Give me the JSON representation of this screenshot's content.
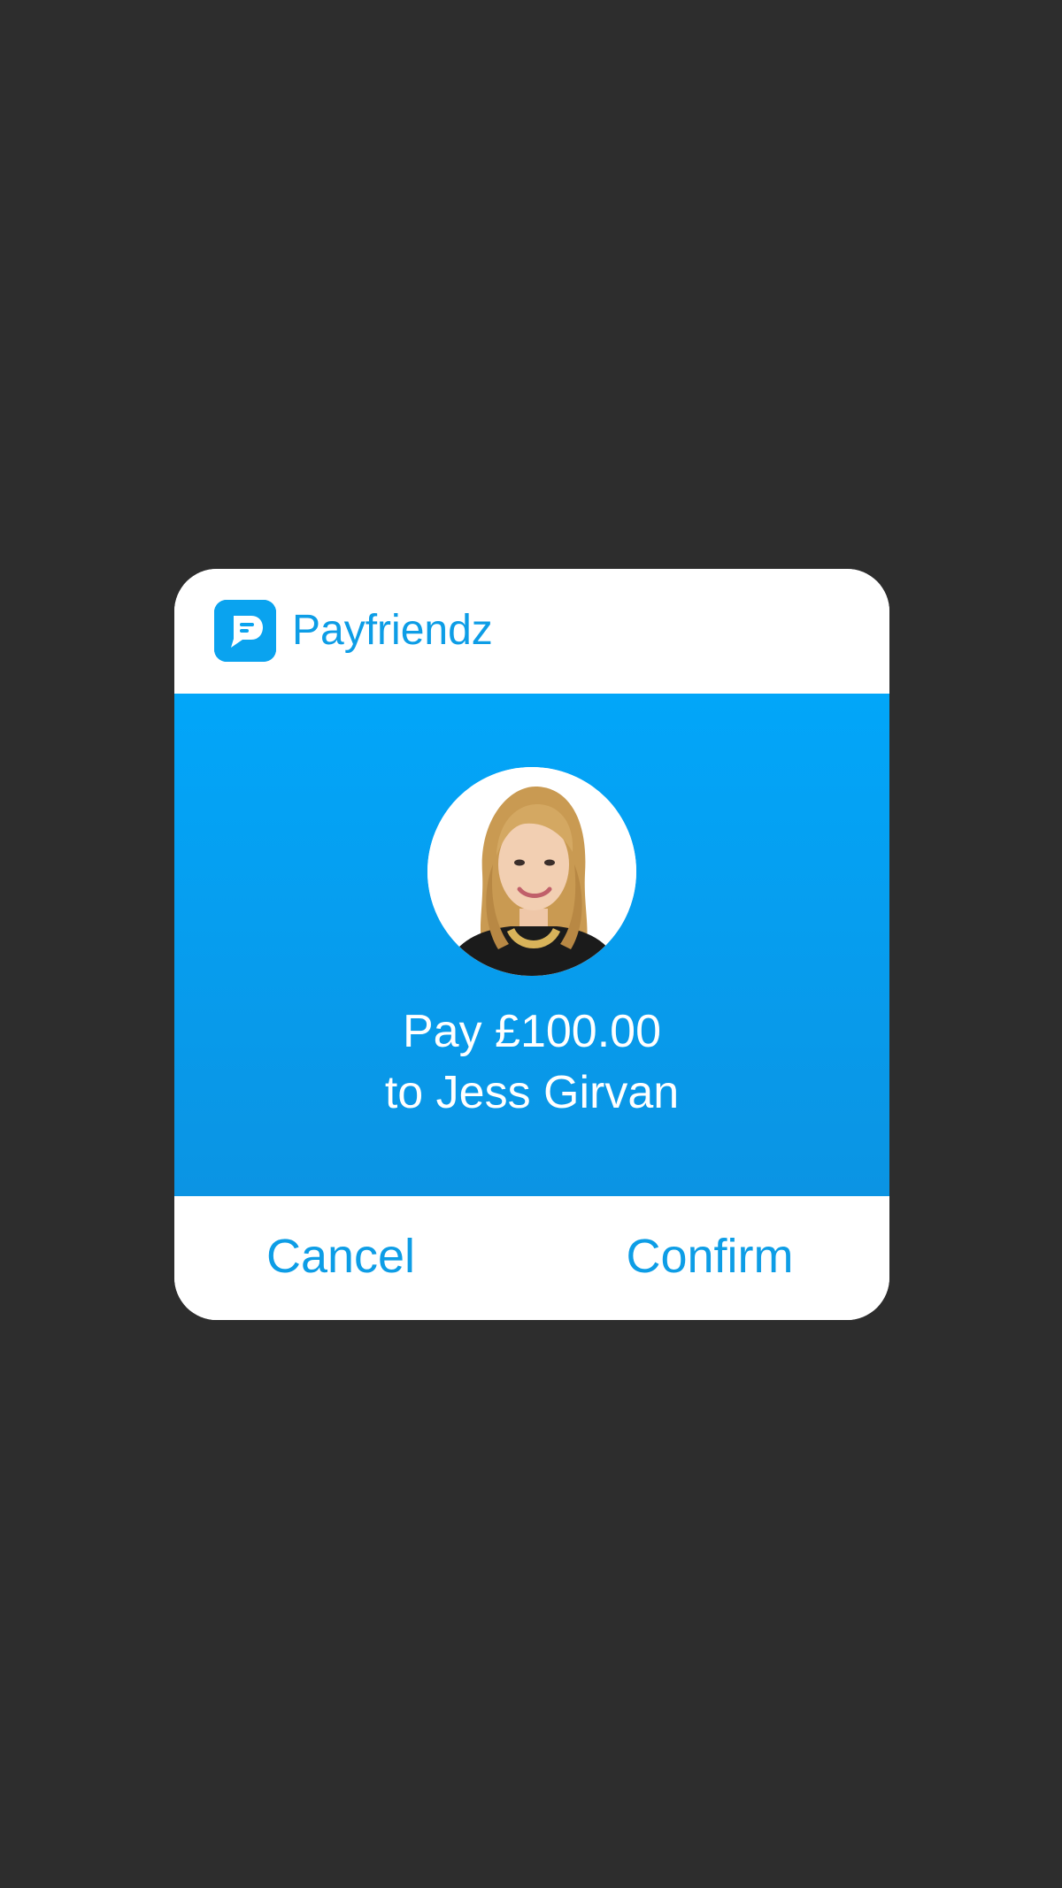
{
  "app": {
    "name": "Payfriendz",
    "icon": "payfriendz-logo-icon",
    "accent_color": "#0aa3ef"
  },
  "payment": {
    "amount_line": "Pay £100.00",
    "recipient_line": "to Jess Girvan",
    "avatar_icon": "recipient-avatar"
  },
  "actions": {
    "cancel_label": "Cancel",
    "confirm_label": "Confirm"
  },
  "colors": {
    "background": "#2d2d2d",
    "panel_top": "#02a6f9",
    "panel_bottom": "#0b94e3",
    "text_accent": "#0d9de6"
  }
}
